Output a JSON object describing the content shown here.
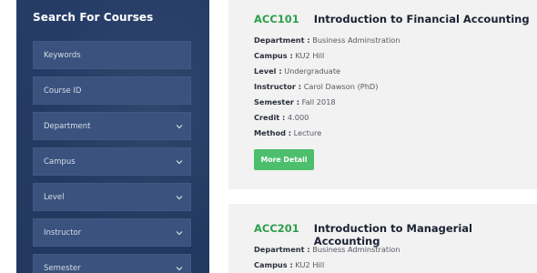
{
  "sidebar": {
    "title": "Search For Courses",
    "fields": [
      {
        "label": "Keywords",
        "type": "input"
      },
      {
        "label": "Course ID",
        "type": "input"
      },
      {
        "label": "Department",
        "type": "select"
      },
      {
        "label": "Campus",
        "type": "select"
      },
      {
        "label": "Level",
        "type": "select"
      },
      {
        "label": "Instructor",
        "type": "select"
      },
      {
        "label": "Semester",
        "type": "select"
      }
    ]
  },
  "courses": [
    {
      "code": "ACC101",
      "title": "Introduction to Financial Accounting",
      "details": [
        {
          "key": "Department :",
          "value": "Business Adminstration"
        },
        {
          "key": "Campus :",
          "value": "KU2 Hill"
        },
        {
          "key": "Level :",
          "value": "Undergraduate"
        },
        {
          "key": "Instructor :",
          "value": "Carol Dawson (PhD)"
        },
        {
          "key": "Semester :",
          "value": "Fall 2018"
        },
        {
          "key": "Credit :",
          "value": "4.000"
        },
        {
          "key": "Method :",
          "value": "Lecture"
        }
      ],
      "button": "More Detail"
    },
    {
      "code": "ACC201",
      "title": "Introduction to Managerial Accounting",
      "details": [
        {
          "key": "Department :",
          "value": "Business Adminstration"
        },
        {
          "key": "Campus :",
          "value": "KU2 Hill"
        }
      ]
    }
  ],
  "colors": {
    "sidebar_bg": "#243a63",
    "field_bg": "#3a527d",
    "accent_green": "#2e9e4c",
    "button_green": "#4cbe6c",
    "card_bg": "#f2f2f2"
  }
}
